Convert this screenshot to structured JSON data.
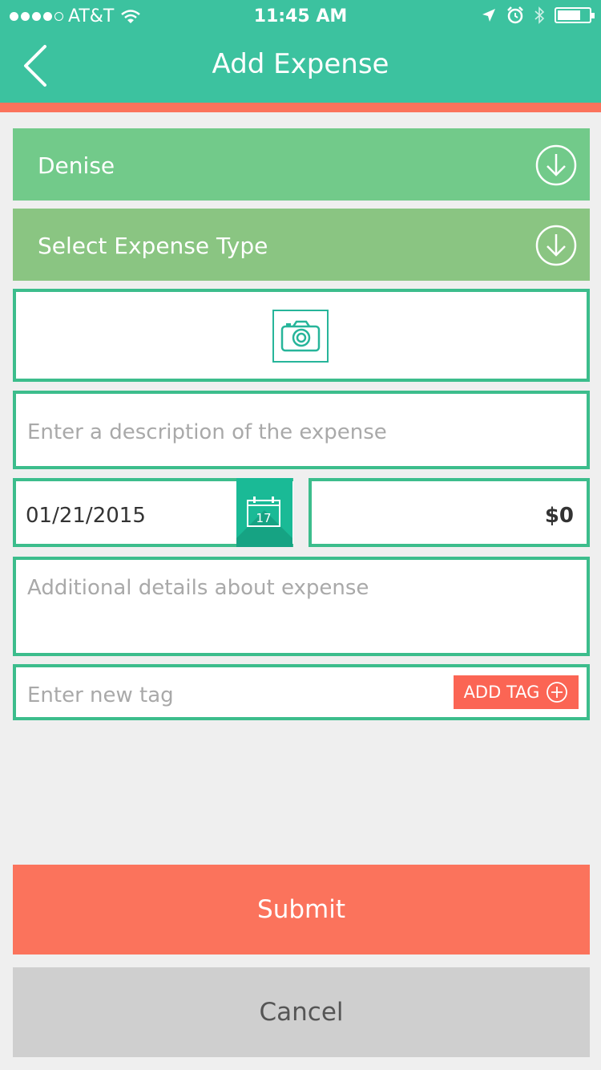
{
  "status_bar": {
    "carrier": "AT&T",
    "time": "11:45 AM",
    "signal_bars": 4,
    "icons": [
      "wifi-icon",
      "location-arrow-icon",
      "alarm-icon",
      "bluetooth-icon",
      "battery-icon"
    ]
  },
  "header": {
    "title": "Add Expense",
    "back_icon": "chevron-left-icon"
  },
  "form": {
    "employee_dropdown": {
      "value": "Denise",
      "icon": "arrow-down-circle-icon"
    },
    "expense_type_dropdown": {
      "value": "Select Expense Type",
      "icon": "arrow-down-circle-icon"
    },
    "photo": {
      "icon": "camera-icon"
    },
    "description": {
      "placeholder": "Enter a description of the expense"
    },
    "date": {
      "value": "01/21/2015",
      "icon": "calendar-icon",
      "icon_day": "17"
    },
    "amount": {
      "value": "$0"
    },
    "details": {
      "placeholder": "Additional details about expense"
    },
    "tag": {
      "placeholder": "Enter new tag",
      "button_label": "ADD TAG",
      "button_icon": "plus-circle-icon"
    }
  },
  "actions": {
    "submit_label": "Submit",
    "cancel_label": "Cancel"
  },
  "colors": {
    "header": "#3cc29f",
    "accent": "#fb735c",
    "dropdown_1": "#72ca8a",
    "dropdown_2": "#8ac582",
    "field_border": "#3cbd8c",
    "calendar_button": "#1aba96",
    "cancel": "#cfcfcf"
  }
}
